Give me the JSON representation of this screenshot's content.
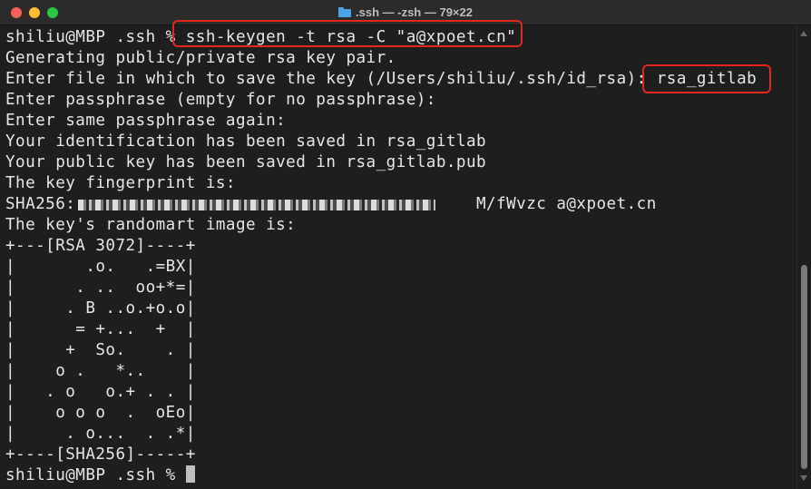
{
  "window": {
    "title": ".ssh — -zsh — 79×22",
    "title_icon": "folder-icon"
  },
  "terminal": {
    "lines": [
      "shiliu@MBP .ssh % ssh-keygen -t rsa -C \"a@xpoet.cn\"",
      "Generating public/private rsa key pair.",
      "Enter file in which to save the key (/Users/shiliu/.ssh/id_rsa): rsa_gitlab",
      "Enter passphrase (empty for no passphrase):",
      "Enter same passphrase again:",
      "Your identification has been saved in rsa_gitlab",
      "Your public key has been saved in rsa_gitlab.pub",
      "The key fingerprint is:",
      "SHA256:                                        M/fWvzc a@xpoet.cn",
      "The key's randomart image is:",
      "+---[RSA 3072]----+",
      "|       .o.   .=BX|",
      "|      . ..  oo+*=|",
      "|     . B ..o.+o.o|",
      "|      = +...  +  |",
      "|     +  So.    . |",
      "|    o .   *..    |",
      "|   . o   o.+ . . |",
      "|    o o o  .  oEo|",
      "|     . o...  . .*|",
      "+----[SHA256]-----+",
      "shiliu@MBP .ssh % "
    ]
  },
  "colors": {
    "background": "#1e1e1e",
    "text": "#e6e6e6",
    "highlight_box": "#e4271d"
  }
}
